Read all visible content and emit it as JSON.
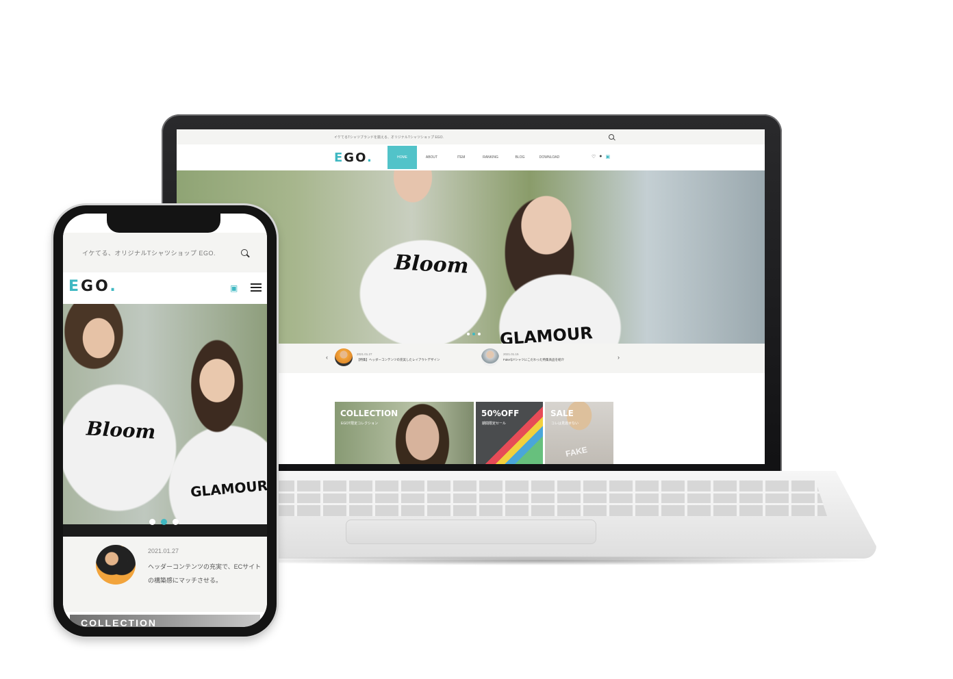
{
  "laptop": {
    "topbar_text": "イケてるTシャツブランドを揃える、オリジナルTシャツショップ EGO.",
    "logo_main": "EGO",
    "logo_accent_char": "E",
    "logo_dot": ".",
    "nav": [
      "HOME",
      "ABOUT",
      "ITEM",
      "RANKING",
      "BLOG",
      "DOWNLOAD"
    ],
    "icons": {
      "favorite": "♡",
      "account": "👤",
      "cart": "🛒"
    },
    "hero": {
      "text1": "Bloom",
      "text2": "GLAMOUR"
    },
    "news": [
      {
        "date": "2021.01.27",
        "text": "【特集】ヘッダーコンテンツの充実したレイアウトデザイン"
      },
      {
        "date": "2021.01.15",
        "text": "FakeなTシャツにこだわった特集商品を紹介"
      }
    ],
    "banners": [
      {
        "title": "COLLECTION",
        "sub": "EGOT限定コレクション"
      },
      {
        "title": "50%OFF",
        "sub": "期間限定セール"
      },
      {
        "title": "SALE",
        "sub": "コレは見逃せない",
        "extra": "FAKE"
      }
    ]
  },
  "phone": {
    "topbar_text": "イケてる、オリジナルTシャツショップ EGO.",
    "logo_main": "EGO",
    "logo_accent_char": "E",
    "logo_dot": ".",
    "hero": {
      "text1": "Bloom",
      "text2": "GLAMOUR"
    },
    "news": {
      "date": "2021.01.27",
      "text": "ヘッダーコンテンツの充実で、ECサイトの構築感にマッチさせる。"
    },
    "next_section_title": "COLLECTION"
  },
  "colors": {
    "accent": "#3fb8c2",
    "nav_active": "#52c3c9",
    "topbar_bg": "#f4f4f2"
  }
}
